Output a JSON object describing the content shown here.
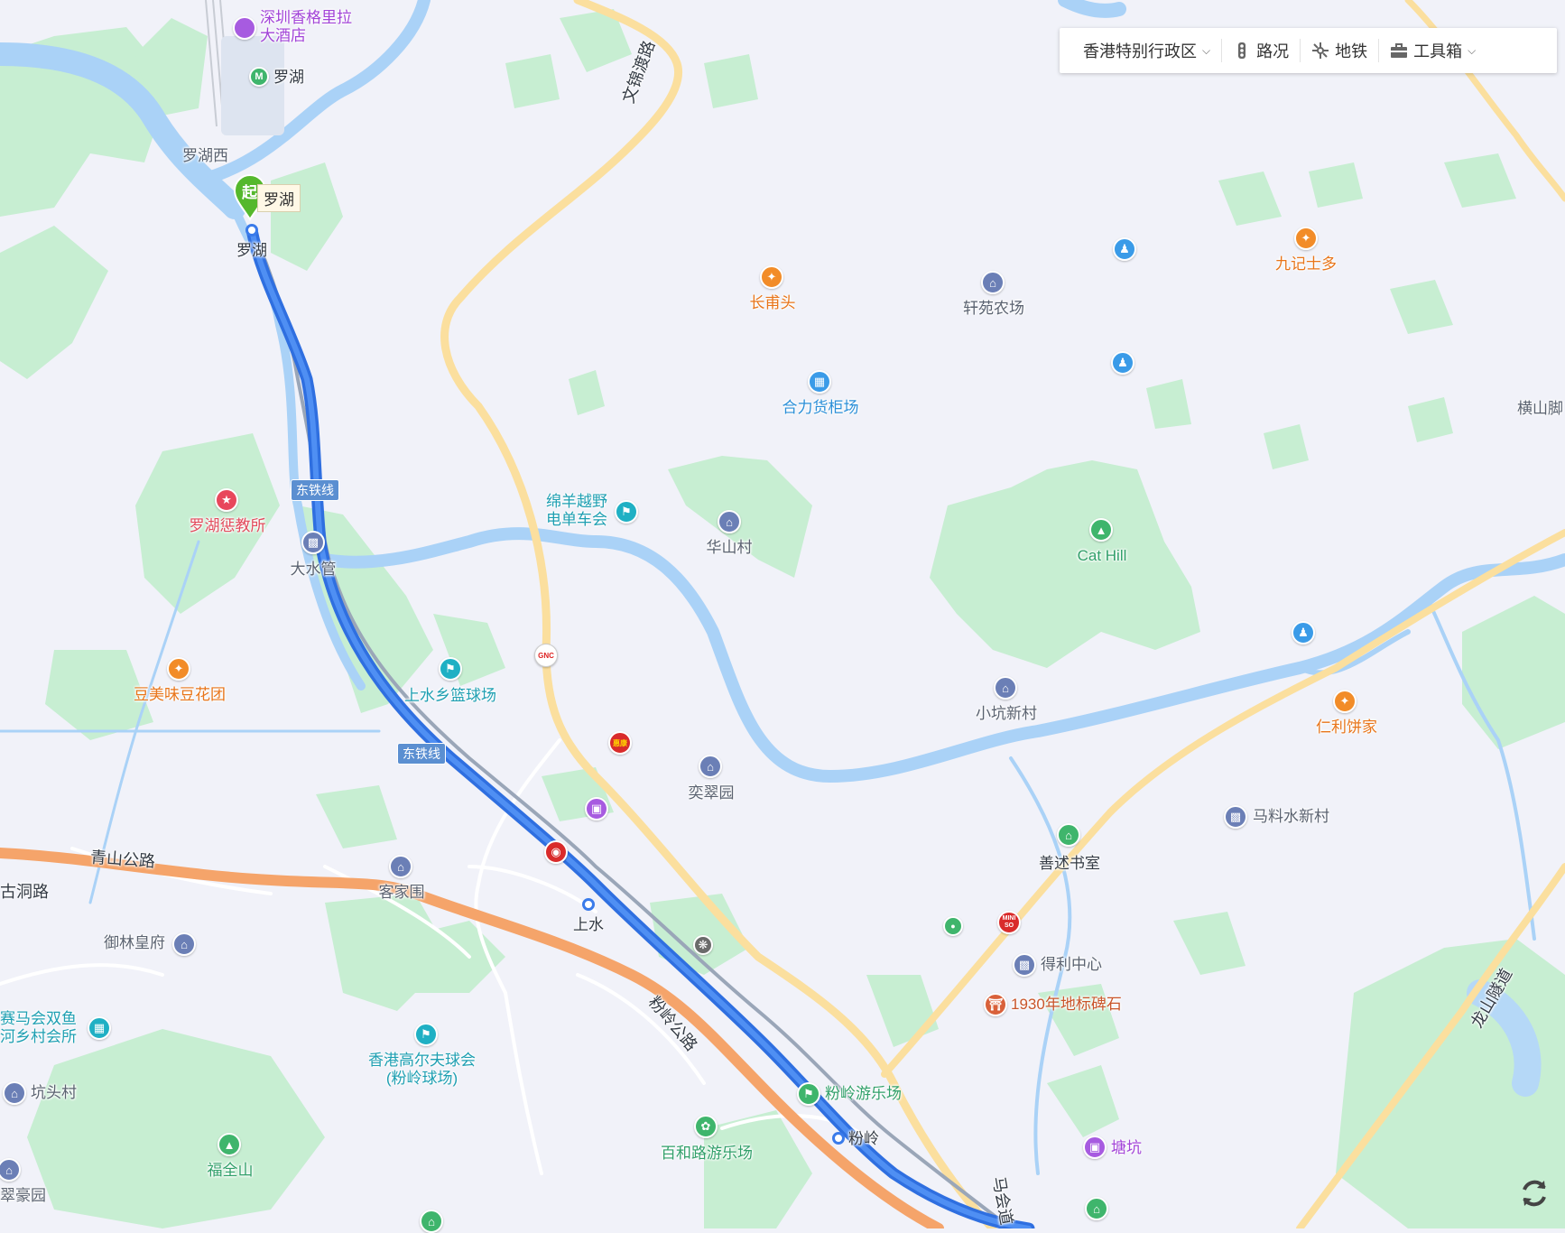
{
  "toolbar": {
    "region": "香港特别行政区",
    "traffic": "路况",
    "subway": "地铁",
    "tools": "工具箱"
  },
  "route": {
    "start_badge": "起",
    "start_callout": "罗湖"
  },
  "rail_badges": {
    "east_rail_1": "东铁线",
    "east_rail_2": "东铁线"
  },
  "stations": {
    "lo_wu": "罗湖",
    "sheung_shui": "上水",
    "fanling": "粉岭",
    "lo_wu_west": "罗湖西",
    "lo_wu_sz": "罗湖"
  },
  "roads": {
    "man_kam_to": "文锦渡路",
    "castle_peak": "青山公路",
    "fanling_hwy": "粉岭公路",
    "ku_tung": "古洞路",
    "lung_shan": "龙山隧道",
    "ma_wui": "马会道"
  },
  "pois": {
    "shangri_la": "深圳香格里拉\n大酒店",
    "cheung_po_tau": "长甫头",
    "hin_yuen": "轩苑农场",
    "kau_kee": "九记士多",
    "hop_lik": "合力货柜场",
    "wang_shan_keuk": "横山脚",
    "goat_club": "绵羊越野\n电单车会",
    "wa_shan": "华山村",
    "cat_hill": "Cat Hill",
    "lo_wu_prison": "罗湖惩教所",
    "tai_shui_kun": "大水管",
    "bean": "豆美味豆花团",
    "basketball": "上水乡篮球场",
    "siu_hang": "小坑新村",
    "yan_lee": "仁利饼家",
    "yik_chui": "奕翠园",
    "ma_liu_shui": "马料水新村",
    "sin_shut": "善述书室",
    "hakka": "客家围",
    "yu_lam": "御林皇府",
    "jockey": "赛马会双鱼\n河乡村会所",
    "tak_lee": "得利中心",
    "boundary_stone": "1930年地标碑石",
    "golf": "香港高尔夫球会\n(粉岭球场)",
    "hang_tau": "坑头村",
    "fanling_park": "粉岭游乐场",
    "pak_wo": "百和路游乐场",
    "fuk_tsuen": "福全山",
    "tong_hang": "塘坑",
    "hao_garden": "翠豪园"
  },
  "brands": {
    "gnc": "GNC",
    "hui_kang": "惠康",
    "miniso": "MINI\nSO"
  },
  "colors": {
    "route": "#3a7bea",
    "highway": "#f5a46a",
    "main_road": "#fbdf9e",
    "water": "#aad2f7",
    "green": "#c7eed2",
    "background": "#f1f2f9"
  }
}
